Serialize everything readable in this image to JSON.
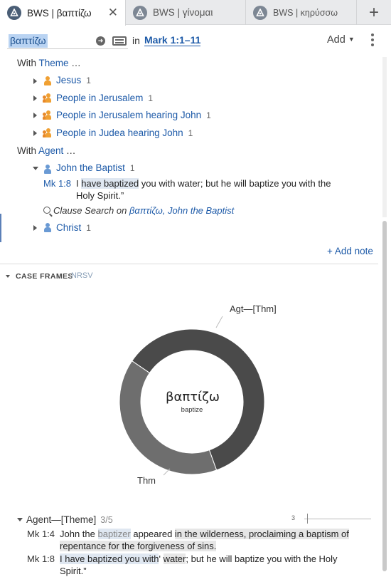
{
  "tabs": [
    {
      "label": "BWS | βαπτίζω",
      "active": true
    },
    {
      "label": "BWS | γίνομαι",
      "active": false
    },
    {
      "label": "BWS | κηρύσσω",
      "active": false
    }
  ],
  "toolbar": {
    "search_value": "βαπτίζω",
    "in_label": "in",
    "range": "Mark 1:1–11",
    "add_label": "Add"
  },
  "with_theme": {
    "prefix": "With",
    "keyword": "Theme",
    "suffix": " …",
    "items": [
      {
        "label": "Jesus",
        "count": "1",
        "icon": "person-icon"
      },
      {
        "label": "People in Jerusalem",
        "count": "1",
        "icon": "group-icon"
      },
      {
        "label": "People in Jerusalem hearing John",
        "count": "1",
        "icon": "group-icon"
      },
      {
        "label": "People in Judea hearing John",
        "count": "1",
        "icon": "group-icon"
      }
    ]
  },
  "with_agent": {
    "prefix": "With",
    "keyword": "Agent",
    "suffix": " …",
    "expanded_item": {
      "label": "John the Baptist",
      "count": "1",
      "icon": "person-icon"
    },
    "verse": {
      "ref": "Mk 1:8",
      "pre": "I ",
      "hl": "have baptized",
      "post": " you with water; but he will baptize you with the",
      "line2": "Holy Spirit.”"
    },
    "clause_search": {
      "label": "Clause Search",
      "on": "on",
      "link": "βαπτίζω, John the Baptist"
    },
    "other_item": {
      "label": "Christ",
      "count": "1",
      "icon": "person-icon"
    }
  },
  "add_note": "+ Add note",
  "case_frames": {
    "title": "CASE FRAMES",
    "version": "NRSV"
  },
  "chart_data": {
    "type": "pie",
    "style": "donut",
    "center_label": "βαπτίζω",
    "center_sublabel": "baptize",
    "slices": [
      {
        "label": "Agt—[Thm]",
        "value": 3,
        "color": "#4a4a4a"
      },
      {
        "label": "Thm",
        "value": 2,
        "color": "#6e6e6e"
      }
    ]
  },
  "frame": {
    "label": "Agent—[Theme]",
    "fraction": "3/5",
    "slider_value": "3",
    "examples": [
      {
        "ref": "Mk 1:4",
        "parts": [
          "John the ",
          "baptizer",
          " appeared ",
          "in the wilderness, proclaiming a baptism of"
        ],
        "line2": "repentance for the forgiveness of sins."
      },
      {
        "ref": "Mk 1:8",
        "parts": [
          "I have baptized you with",
          "' ",
          "water",
          "; but he will baptize you with the Holy"
        ],
        "line2": "Spirit.”"
      }
    ]
  }
}
